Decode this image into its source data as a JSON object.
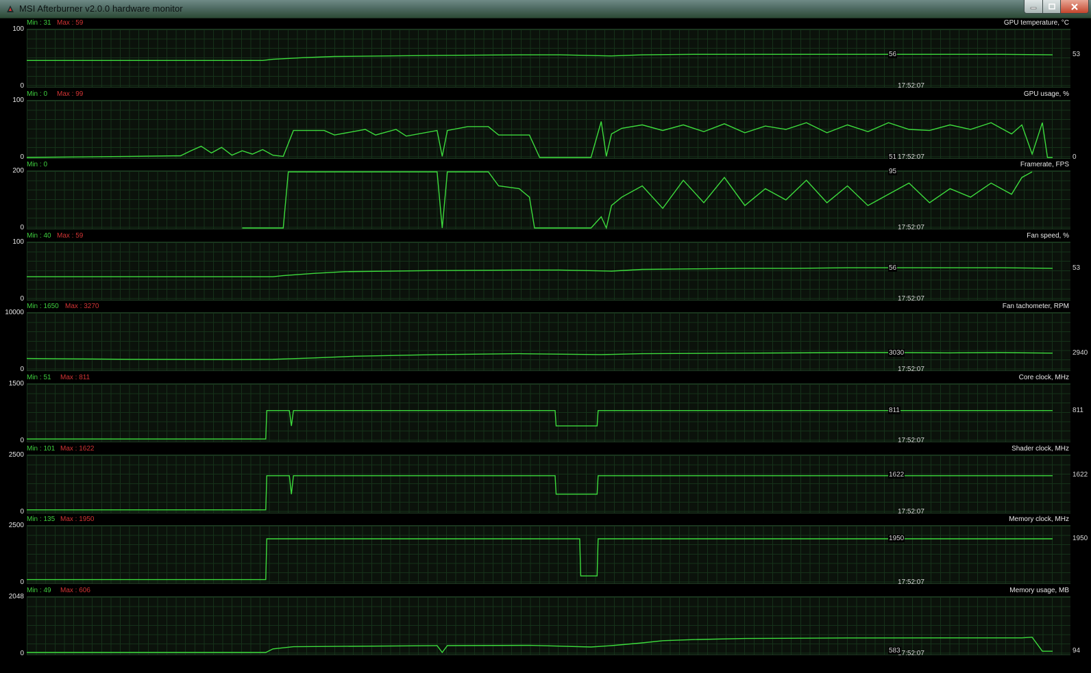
{
  "window": {
    "title": "MSI Afterburner v2.0.0 hardware monitor",
    "icon": "afterburner-app-icon",
    "controls": [
      "minimize-icon",
      "maximize-icon",
      "close-icon"
    ]
  },
  "colors": {
    "trace": "#3ddc3d",
    "grid": "#16321a",
    "min": "#3fd13f",
    "max": "#d23434",
    "text": "#e6e6e6"
  },
  "timestamp": "17:52:07",
  "graphs": [
    {
      "name": "GPU temperature, °C",
      "ymax": "100",
      "ymin": "0",
      "min": "Min : 31",
      "max": "Max : 59",
      "current": "56",
      "right": "53",
      "chart_data": {
        "type": "line",
        "ylim": [
          0,
          100
        ],
        "x": [
          0,
          10,
          20,
          23,
          24,
          27,
          30,
          40,
          48,
          52,
          57,
          60,
          65,
          70,
          75,
          80,
          85,
          90,
          95,
          100
        ],
        "y": [
          46,
          46,
          46,
          46,
          48,
          51,
          53,
          55,
          56,
          56,
          54,
          56,
          57,
          57,
          57,
          57,
          57,
          57,
          57,
          56
        ]
      }
    },
    {
      "name": "GPU usage, %",
      "ymax": "100",
      "ymin": "0",
      "min": "Min : 0",
      "max": "Max : 99",
      "current": "51",
      "right": "0",
      "chart_data": {
        "type": "line",
        "ylim": [
          0,
          100
        ],
        "x": [
          0,
          10,
          15,
          16,
          17,
          18,
          19,
          20,
          21,
          22,
          23,
          24,
          25,
          26,
          29,
          30,
          33,
          34,
          36,
          37,
          40,
          40.5,
          41,
          43,
          45,
          46,
          49,
          50,
          51,
          55,
          56,
          56.5,
          57,
          58,
          60,
          62,
          64,
          66,
          68,
          70,
          72,
          74,
          76,
          78,
          80,
          82,
          84,
          86,
          88,
          90,
          92,
          94,
          96,
          97,
          98,
          99,
          99.5,
          100
        ],
        "y": [
          0,
          2,
          3,
          12,
          20,
          8,
          18,
          4,
          12,
          6,
          14,
          4,
          2,
          48,
          48,
          40,
          50,
          40,
          50,
          38,
          48,
          2,
          48,
          55,
          55,
          40,
          40,
          0,
          0,
          0,
          64,
          2,
          42,
          52,
          58,
          48,
          58,
          46,
          60,
          44,
          56,
          50,
          62,
          44,
          58,
          46,
          62,
          50,
          48,
          58,
          50,
          62,
          42,
          58,
          6,
          62,
          0,
          0
        ]
      }
    },
    {
      "name": "Framerate, FPS",
      "ymax": "200",
      "ymin": "0",
      "min": "Min : 0",
      "max": "",
      "current": "95",
      "right": "",
      "chart_data": {
        "type": "line",
        "ylim": [
          0,
          200
        ],
        "x": [
          21,
          25,
          25.5,
          40,
          40.5,
          41,
          45,
          46,
          48,
          49,
          49.5,
          55,
          56,
          56.5,
          57,
          58,
          60,
          62,
          64,
          66,
          68,
          70,
          72,
          74,
          76,
          78,
          80,
          82,
          84,
          86,
          88,
          90,
          92,
          94,
          96,
          97,
          98
        ],
        "y": [
          0,
          0,
          200,
          200,
          0,
          200,
          200,
          150,
          140,
          110,
          0,
          0,
          40,
          0,
          80,
          110,
          150,
          70,
          170,
          90,
          180,
          80,
          140,
          100,
          170,
          90,
          150,
          80,
          120,
          160,
          90,
          140,
          110,
          160,
          120,
          180,
          200
        ]
      }
    },
    {
      "name": "Fan speed, %",
      "ymax": "100",
      "ymin": "0",
      "min": "Min : 40",
      "max": "Max : 59",
      "current": "56",
      "right": "53",
      "chart_data": {
        "type": "line",
        "ylim": [
          0,
          100
        ],
        "x": [
          0,
          10,
          20,
          24,
          25,
          28,
          31,
          40,
          48,
          52,
          57,
          60,
          65,
          70,
          75,
          80,
          85,
          90,
          95,
          100
        ],
        "y": [
          40,
          40,
          40,
          40,
          42,
          46,
          49,
          51,
          52,
          52,
          50,
          53,
          54,
          55,
          55,
          56,
          56,
          56,
          56,
          55
        ]
      }
    },
    {
      "name": "Fan tachometer, RPM",
      "ymax": "10000",
      "ymin": "0",
      "min": "Min : 1650",
      "max": "Max : 3270",
      "current": "3030",
      "right": "2940",
      "chart_data": {
        "type": "line",
        "ylim": [
          0,
          10000
        ],
        "x": [
          0,
          10,
          20,
          24,
          28,
          32,
          40,
          48,
          56,
          60,
          70,
          80,
          85,
          90,
          95,
          100
        ],
        "y": [
          2000,
          1850,
          1800,
          1850,
          2100,
          2400,
          2700,
          2850,
          2700,
          2850,
          2950,
          3050,
          3050,
          3000,
          3050,
          2950
        ]
      }
    },
    {
      "name": "Core clock, MHz",
      "ymax": "1500",
      "ymin": "0",
      "min": "Min : 51",
      "max": "Max : 811",
      "current": "811",
      "right": "811",
      "chart_data": {
        "type": "line",
        "ylim": [
          0,
          1500
        ],
        "x": [
          0,
          23.3,
          23.4,
          25.6,
          25.8,
          26,
          51.5,
          51.6,
          55.6,
          55.7,
          100
        ],
        "y": [
          51,
          51,
          811,
          811,
          400,
          811,
          811,
          400,
          400,
          811,
          811
        ]
      }
    },
    {
      "name": "Shader clock, MHz",
      "ymax": "2500",
      "ymin": "0",
      "min": "Min : 101",
      "max": "Max : 1622",
      "current": "1622",
      "right": "1622",
      "chart_data": {
        "type": "line",
        "ylim": [
          0,
          2500
        ],
        "x": [
          0,
          23.3,
          23.4,
          25.6,
          25.8,
          26,
          51.5,
          51.6,
          55.6,
          55.7,
          100
        ],
        "y": [
          101,
          101,
          1622,
          1622,
          800,
          1622,
          1622,
          800,
          800,
          1622,
          1622
        ]
      }
    },
    {
      "name": "Memory clock, MHz",
      "ymax": "2500",
      "ymin": "0",
      "min": "Min : 135",
      "max": "Max : 1950",
      "current": "1950",
      "right": "1950",
      "chart_data": {
        "type": "line",
        "ylim": [
          0,
          2500
        ],
        "x": [
          0,
          23.3,
          23.4,
          53.9,
          54,
          55.6,
          55.7,
          100
        ],
        "y": [
          135,
          135,
          1950,
          1950,
          300,
          300,
          1950,
          1950
        ]
      }
    },
    {
      "name": "Memory usage, MB",
      "ymax": "2048",
      "ymin": "0",
      "min": "Min : 49",
      "max": "Max : 606",
      "current": "583",
      "right": "94",
      "chart_data": {
        "type": "line",
        "ylim": [
          0,
          2048
        ],
        "x": [
          0,
          23.3,
          24,
          26,
          40,
          40.5,
          41,
          49,
          55,
          57,
          60,
          62,
          65,
          70,
          80,
          90,
          96,
          97,
          98,
          99,
          100
        ],
        "y": [
          49,
          49,
          180,
          260,
          300,
          49,
          300,
          310,
          250,
          300,
          400,
          480,
          520,
          560,
          580,
          583,
          583,
          583,
          606,
          94,
          94
        ]
      }
    }
  ]
}
